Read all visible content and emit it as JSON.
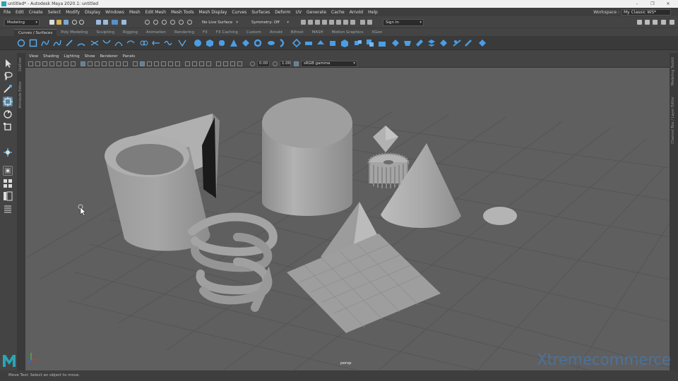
{
  "window": {
    "title": "untitled* - Autodesk Maya 2020.1: untitled",
    "controls": [
      "–",
      "❐",
      "✕"
    ]
  },
  "menubar": {
    "items": [
      "File",
      "Edit",
      "Create",
      "Select",
      "Modify",
      "Display",
      "Windows",
      "Mesh",
      "Edit Mesh",
      "Mesh Tools",
      "Mesh Display",
      "Curves",
      "Surfaces",
      "Deform",
      "UV",
      "Generate",
      "Cache",
      "Arnold",
      "Help"
    ],
    "workspace_label": "Workspace :",
    "workspace_value": "My Classic WS*"
  },
  "statusline": {
    "menu_set": "Modeling",
    "live_surface": "No Live Surface",
    "symmetry": "Symmetry: Off",
    "sign_in": "Sign In"
  },
  "shelf": {
    "tabs": [
      "Curves / Surfaces",
      "Poly Modeling",
      "Sculpting",
      "Rigging",
      "Animation",
      "Rendering",
      "FX",
      "FX Caching",
      "Custom",
      "Arnold",
      "Bifrost",
      "MASH",
      "Motion Graphics",
      "XGen"
    ],
    "active_tab": "Curves / Surfaces"
  },
  "side_panels": {
    "left": [
      "Outliner",
      "Attribute Editor"
    ],
    "right": [
      "Modeling Toolkit",
      "Channel Box / Layer Editor"
    ]
  },
  "panel": {
    "menus": [
      "View",
      "Shading",
      "Lighting",
      "Show",
      "Renderer",
      "Panels"
    ],
    "exposure": "0.00",
    "gamma": "1.00",
    "color_space": "sRGB gamma",
    "camera": "persp"
  },
  "helpline": {
    "text": "Move Tool: Select an object to move."
  },
  "watermark": {
    "text_a": "Xtreme",
    "text_b": "commerce"
  },
  "colors": {
    "accent": "#3d8fd6",
    "viewport_bg": "#5f5f5f",
    "grid": "#525252",
    "object": "#a9a9a9"
  }
}
